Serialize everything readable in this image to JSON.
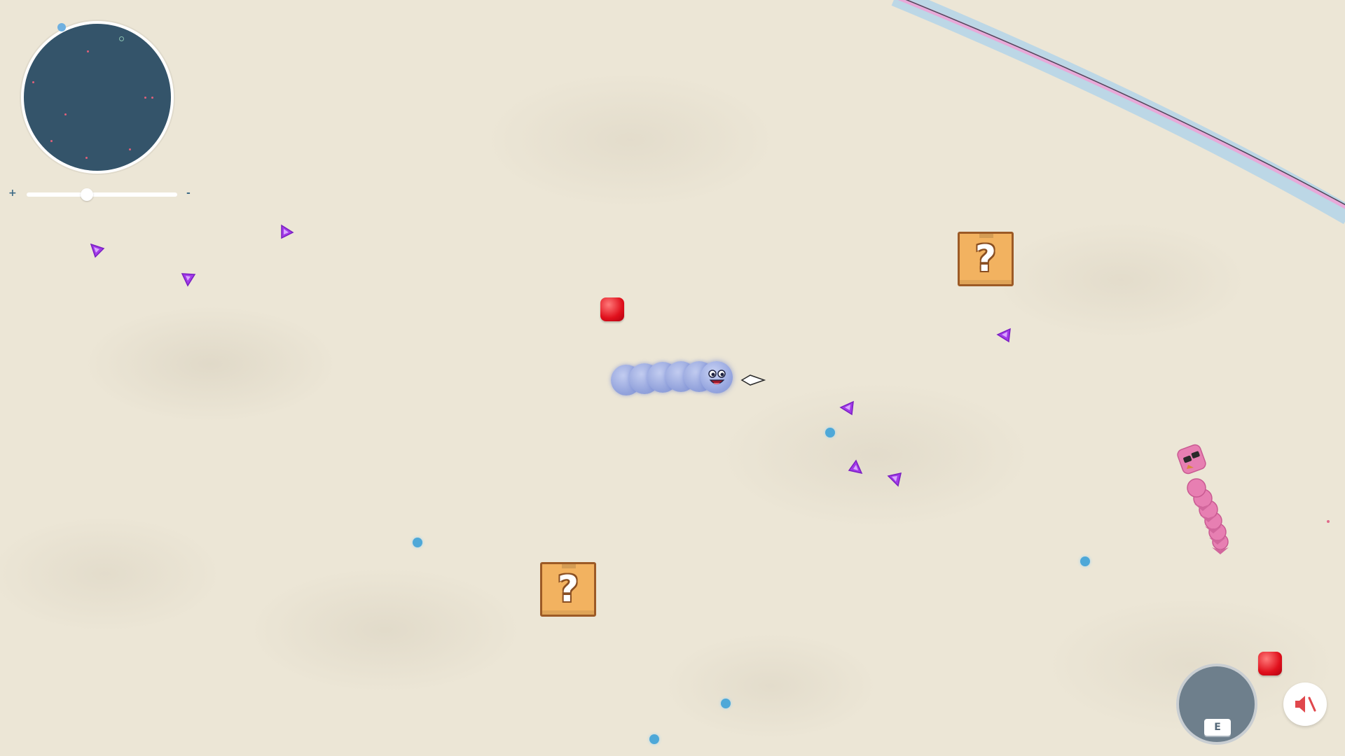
{
  "game": {
    "minimap": {
      "label": "minimap"
    },
    "zoom": {
      "plus": "+",
      "minus": "-",
      "level": 0.4
    },
    "mystery_box_glyph": "?",
    "ability": {
      "key": "E"
    },
    "sound": {
      "state": "muted",
      "icon": "speaker-muted-icon"
    },
    "colors": {
      "background": "#ece6d6",
      "minimap": "#34546a",
      "player_snake": "#93a3dc",
      "enemy_snake": "#e77fb2",
      "boundary_pink": "#e8a8d8",
      "boundary_blue": "#a8d0ec",
      "gem": "#a23ae8",
      "orb": "#4ea8d8",
      "candy": "#e0101c",
      "box": "#f2b260"
    }
  }
}
